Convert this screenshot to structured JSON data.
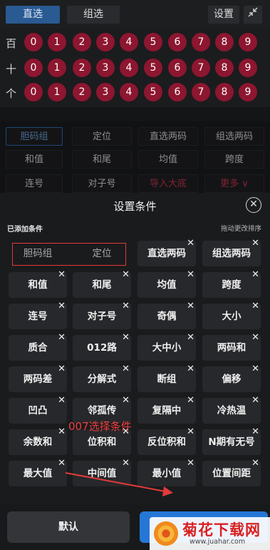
{
  "header": {
    "tab_direct": "直选",
    "tab_group": "组选",
    "settings": "设置"
  },
  "digit_rows": [
    {
      "label": "百",
      "digits": [
        "0",
        "1",
        "2",
        "3",
        "4",
        "5",
        "6",
        "7",
        "8",
        "9"
      ]
    },
    {
      "label": "十",
      "digits": [
        "0",
        "1",
        "2",
        "3",
        "4",
        "5",
        "6",
        "7",
        "8",
        "9"
      ]
    },
    {
      "label": "个",
      "digits": [
        "0",
        "1",
        "2",
        "3",
        "4",
        "5",
        "6",
        "7",
        "8",
        "9"
      ]
    }
  ],
  "conditions_bg": [
    [
      "胆码组",
      "定位",
      "直选两码",
      "组选两码"
    ],
    [
      "和值",
      "和尾",
      "均值",
      "跨度"
    ],
    [
      "连号",
      "对子号",
      "导入大底",
      "更多 ∨"
    ]
  ],
  "sheet": {
    "title": "设置条件",
    "added_label": "已添加条件",
    "drag_label": "拖动更改排序",
    "ghost_items": [
      "胆码组",
      "定位"
    ],
    "items": [
      "直选两码",
      "组选两码",
      "和值",
      "和尾",
      "均值",
      "跨度",
      "连号",
      "对子号",
      "奇偶",
      "大小",
      "质合",
      "012路",
      "大中小",
      "两码和",
      "两码差",
      "分解式",
      "断组",
      "偏移",
      "凹凸",
      "邻孤传",
      "复隔中",
      "冷热温",
      "余数和",
      "位积和",
      "反位积和",
      "N期有无号",
      "最大值",
      "中间值",
      "最小值",
      "位置间距"
    ],
    "annotation": "007选择条件",
    "btn_default": "默认"
  },
  "watermark": {
    "title": "菊花下载网",
    "url": "www.juahar.com"
  }
}
